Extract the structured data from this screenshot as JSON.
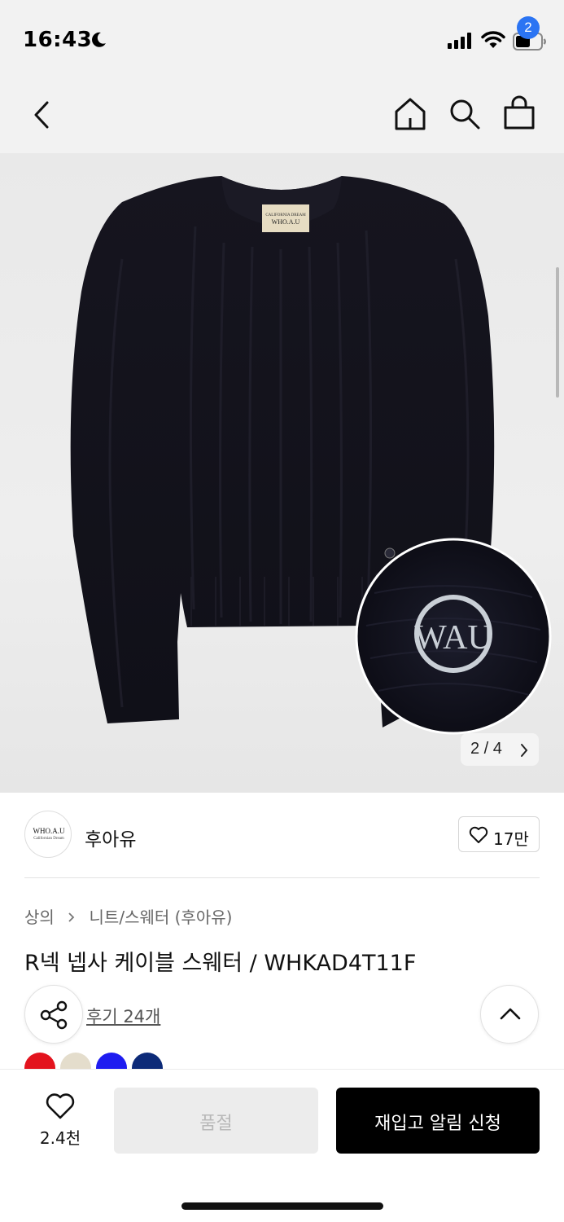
{
  "status_bar": {
    "time": "16:43",
    "icons": [
      "moon-icon",
      "signal-icon",
      "wifi-icon",
      "battery-icon"
    ]
  },
  "header": {
    "icons": [
      "back-icon",
      "home-icon",
      "search-icon",
      "shopping-bag-icon"
    ],
    "cart_badge": "2"
  },
  "gallery": {
    "pager_text": "2 / 4",
    "current": 2,
    "total": 4,
    "image_description_icons": [
      "sweater-image",
      "logo-closeup-image"
    ],
    "logo_letters": "WAU",
    "label_line1": "CALIFORNIA DREAM",
    "label_line2": "WHO.A.U"
  },
  "brand": {
    "logo_text": "WHO.A.U",
    "logo_subtext": "Californian Dream",
    "name": "후아유",
    "like_count": "17만"
  },
  "breadcrumb": {
    "items": [
      "상의",
      "니트/스웨터 (후아유)"
    ]
  },
  "product": {
    "title": "R넥 넵사 케이블 스웨터 / WHKAD4T11F",
    "review_link": "후기 24개",
    "swatch_colors": [
      "#e3131d",
      "#e4ddcc",
      "#1e1cf0",
      "#0c2a78"
    ]
  },
  "bottom_bar": {
    "wish_count": "2.4천",
    "soldout_label": "품절",
    "restock_label": "재입고 알림 신청"
  },
  "colors": {
    "badge": "#2b74f3",
    "primary_button": "#000000",
    "disabled_button": "#ececec",
    "sweater": "#14131f"
  }
}
